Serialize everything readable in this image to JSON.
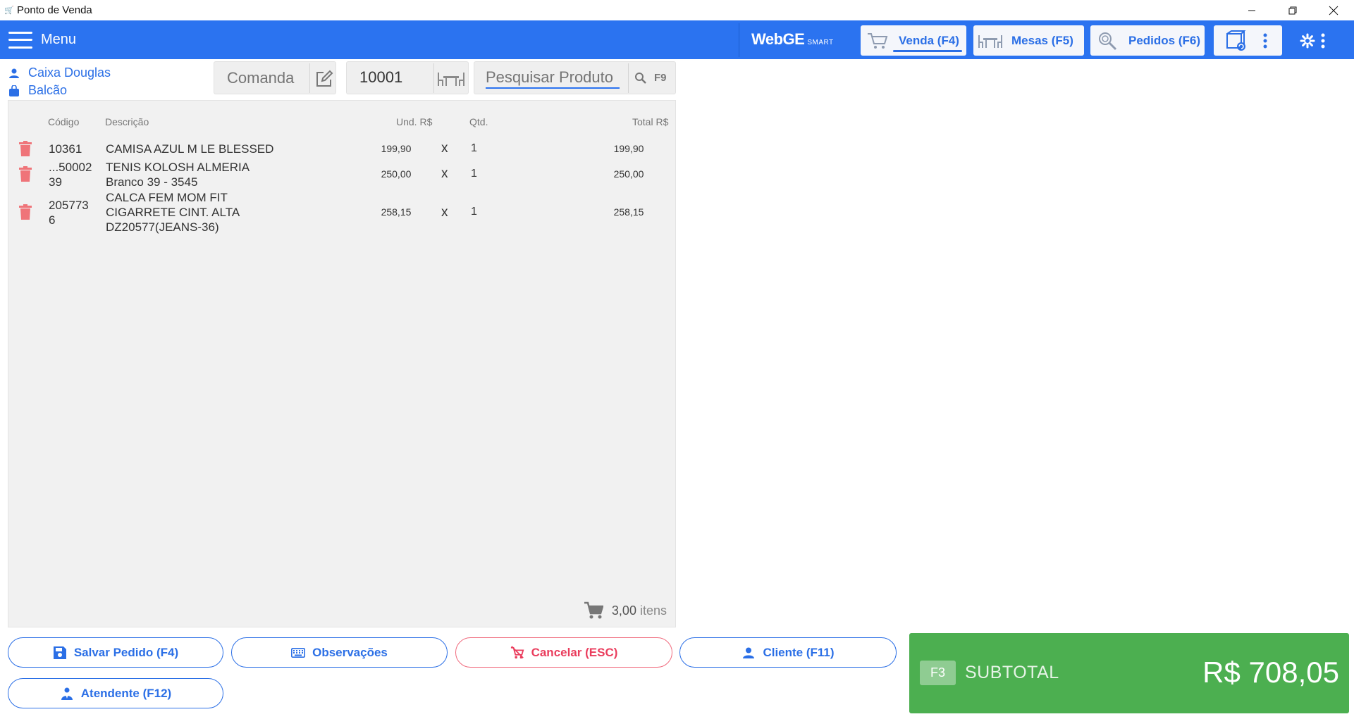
{
  "window": {
    "title": "Ponto de Venda",
    "app_icon": "cart-icon"
  },
  "header": {
    "menu_label": "Menu",
    "brand_main": "WebGE",
    "brand_sub": "SMART",
    "tabs": [
      {
        "label": "Venda (F4)",
        "icon": "cart-icon",
        "active": true
      },
      {
        "label": "Mesas (F5)",
        "icon": "tables-icon",
        "active": false
      },
      {
        "label": "Pedidos (F6)",
        "icon": "search-orders-icon",
        "active": false
      }
    ]
  },
  "session": {
    "operator": "Caixa Douglas",
    "location": "Balcão"
  },
  "order_bar": {
    "comanda_placeholder": "Comanda",
    "mesa_value": "10001",
    "search_placeholder": "Pesquisar Produto",
    "search_shortcut": "F9"
  },
  "table": {
    "columns": {
      "code": "Código",
      "description": "Descrição",
      "unit": "Und. R$",
      "qty": "Qtd.",
      "total": "Total R$"
    },
    "rows": [
      {
        "code": "10361",
        "description": "CAMISA AZUL M LE BLESSED",
        "unit": "199,90",
        "x": "x",
        "qty": "1",
        "total": "199,90"
      },
      {
        "code": "...5000239",
        "description": "TENIS KOLOSH ALMERIA Branco 39 - 3545",
        "unit": "250,00",
        "x": "x",
        "qty": "1",
        "total": "250,00"
      },
      {
        "code": "2057736",
        "description": "CALCA FEM MOM FIT CIGARRETE CINT. ALTA DZ20577(JEANS-36)",
        "unit": "258,15",
        "x": "x",
        "qty": "1",
        "total": "258,15"
      }
    ],
    "items_count": "3,00",
    "items_word": "itens"
  },
  "actions": {
    "save": "Salvar Pedido (F4)",
    "notes": "Observações",
    "cancel": "Cancelar (ESC)",
    "client": "Cliente (F11)",
    "attendant": "Atendente (F12)"
  },
  "subtotal": {
    "shortcut": "F3",
    "label": "SUBTOTAL",
    "value": "R$ 708,05"
  },
  "colors": {
    "primary": "#2b73f0",
    "success": "#4caf50",
    "danger": "#ea3d5d",
    "panel": "#f1f1f1"
  }
}
